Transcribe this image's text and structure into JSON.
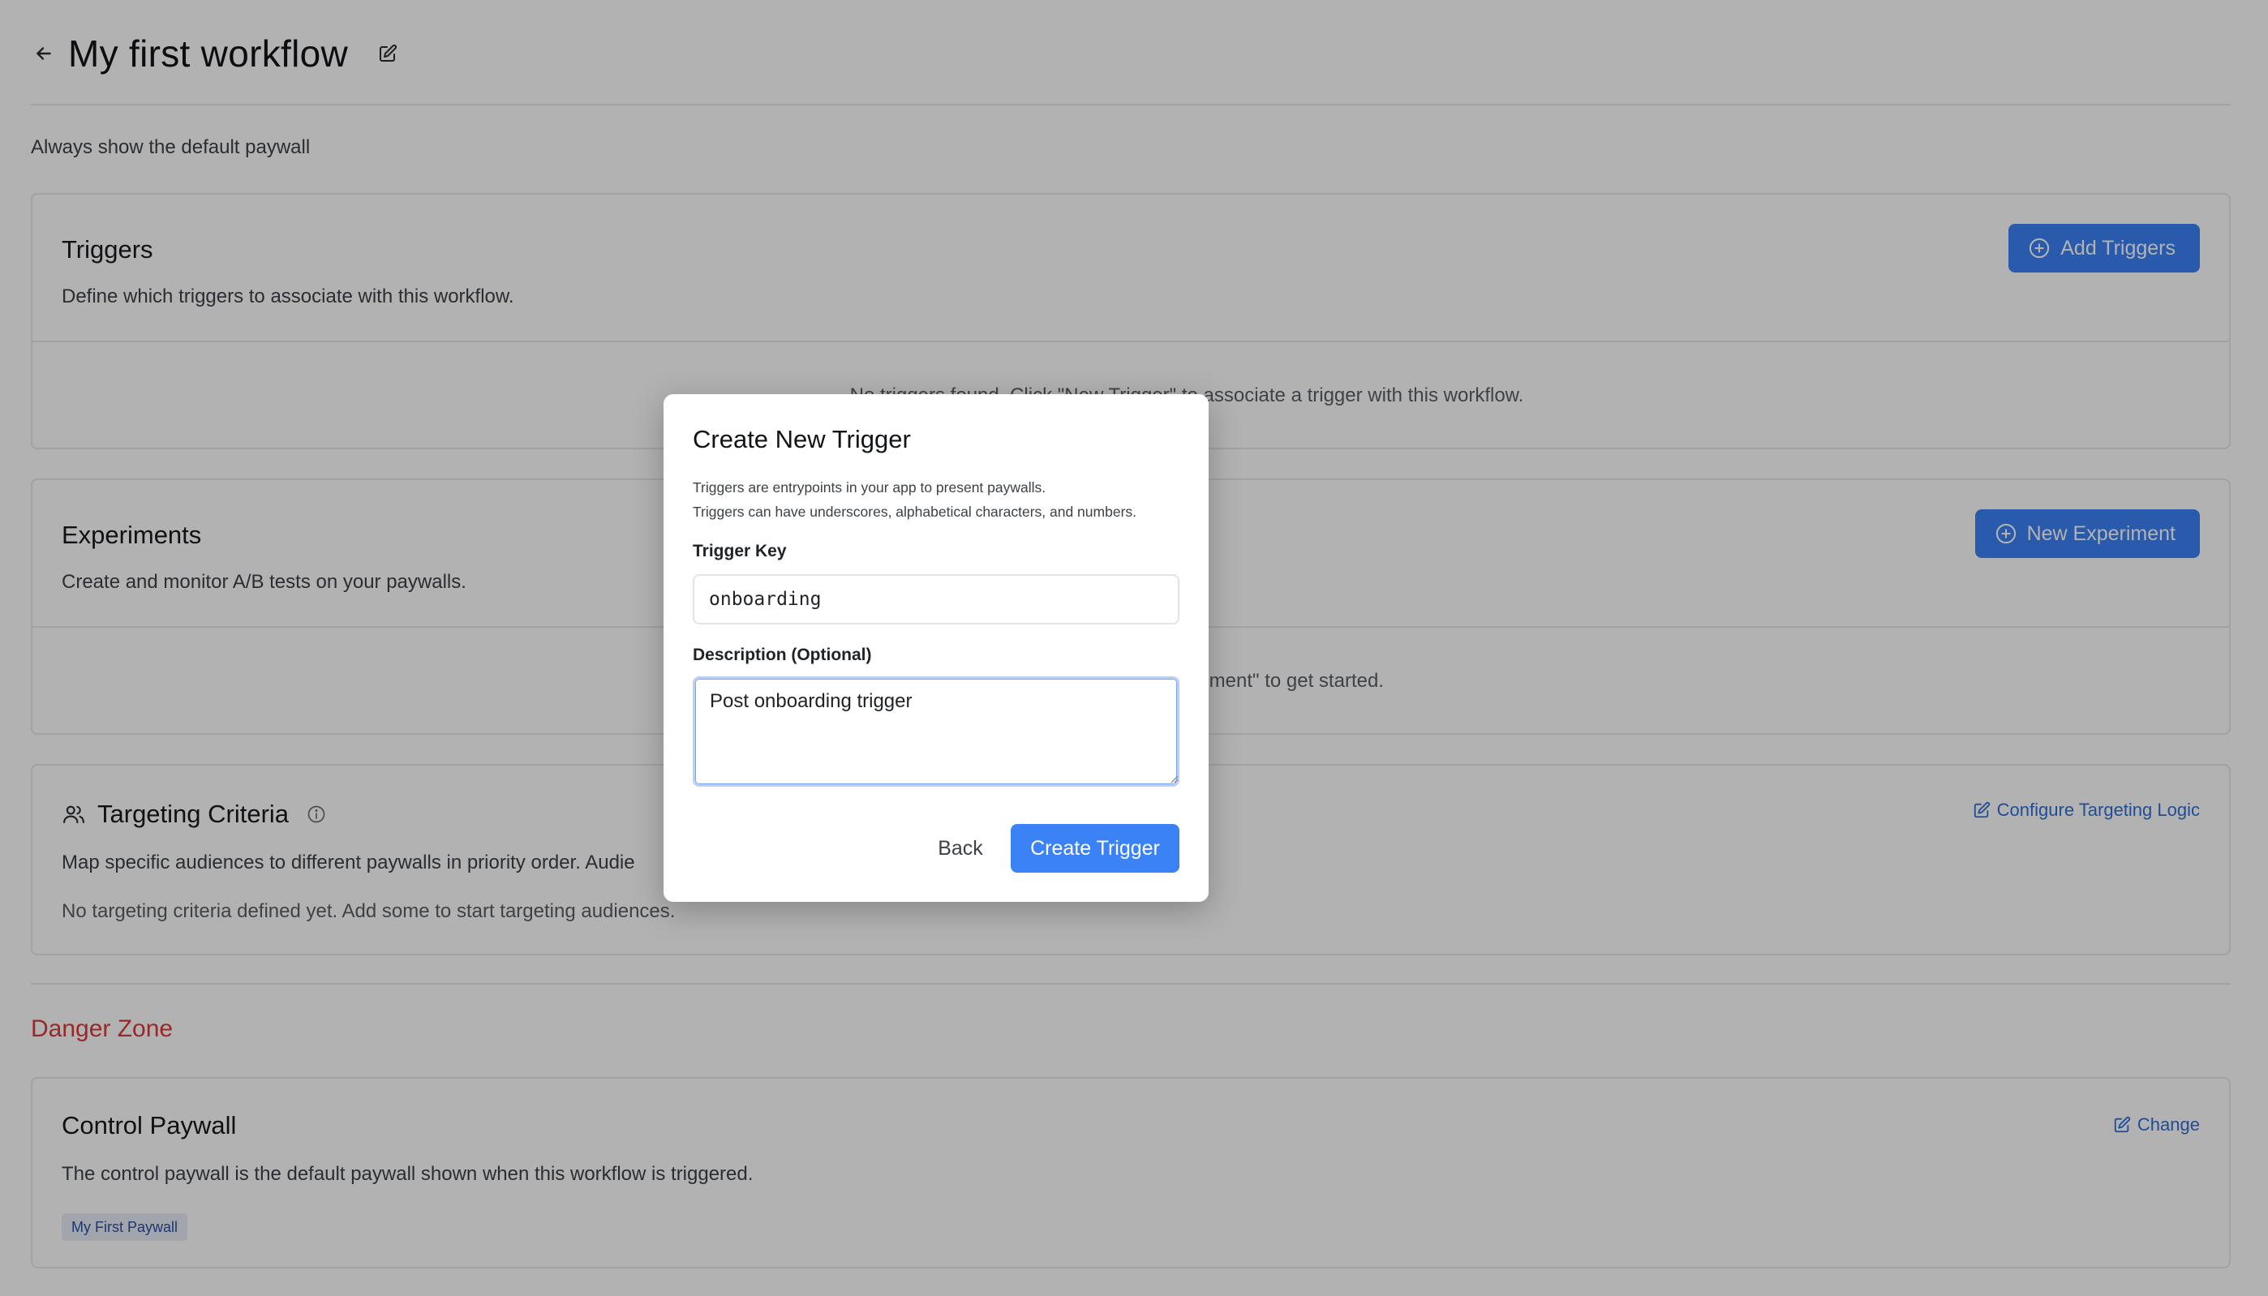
{
  "header": {
    "title": "My first workflow"
  },
  "subtitle": "Always show the default paywall",
  "triggers": {
    "title": "Triggers",
    "description": "Define which triggers to associate with this workflow.",
    "add_button": "Add Triggers",
    "empty_message": "No triggers found. Click \"New Trigger\" to associate a trigger with this workflow."
  },
  "experiments": {
    "title": "Experiments",
    "description": "Create and monitor A/B tests on your paywalls.",
    "new_button": "New Experiment",
    "empty_message_visible": "eriment\" to get started."
  },
  "targeting": {
    "title": "Targeting Criteria",
    "description": "Map specific audiences to different paywalls in priority order. Audie",
    "empty_message": "No targeting criteria defined yet. Add some to start targeting audiences.",
    "configure_link": "Configure Targeting Logic"
  },
  "danger_zone": {
    "title": "Danger Zone"
  },
  "control_paywall": {
    "title": "Control Paywall",
    "description": "The control paywall is the default paywall shown when this workflow is triggered.",
    "change_link": "Change",
    "chip": "My First Paywall"
  },
  "modal": {
    "title": "Create New Trigger",
    "desc_line1": "Triggers are entrypoints in your app to present paywalls.",
    "desc_line2": "Triggers can have underscores, alphabetical characters, and numbers.",
    "trigger_key_label": "Trigger Key",
    "trigger_key_value": "onboarding",
    "description_label": "Description (Optional)",
    "description_value": "Post onboarding trigger",
    "back_button": "Back",
    "create_button": "Create Trigger"
  },
  "colors": {
    "primary": "#3b82f6",
    "danger": "#dc3a3a",
    "link": "#2f6fd6"
  },
  "icons": [
    "arrow-left-icon",
    "pencil-square-icon",
    "plus-circle-icon",
    "users-icon",
    "info-icon",
    "resize-grip-icon"
  ]
}
